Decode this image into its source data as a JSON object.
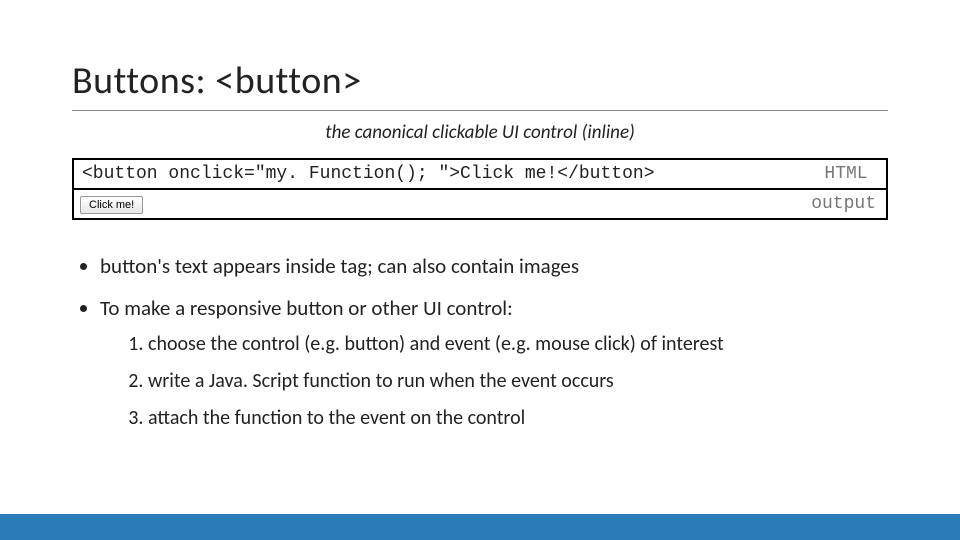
{
  "title": "Buttons: <button>",
  "subtitle": "the canonical clickable UI control (inline)",
  "code": {
    "html_line": "<button onclick=\"my. Function(); \">Click me!</button>",
    "html_label": "HTML",
    "output_label": "output",
    "button_text": "Click me!"
  },
  "bullets": [
    "button's text appears inside tag; can also contain images",
    "To make a responsive button or other UI control:"
  ],
  "steps": [
    "choose the control (e.g. button) and event (e.g. mouse click) of interest",
    "write a Java. Script function to run when the event occurs",
    "attach the function to the event on the control"
  ],
  "colors": {
    "accent": "#2b7bb9"
  }
}
